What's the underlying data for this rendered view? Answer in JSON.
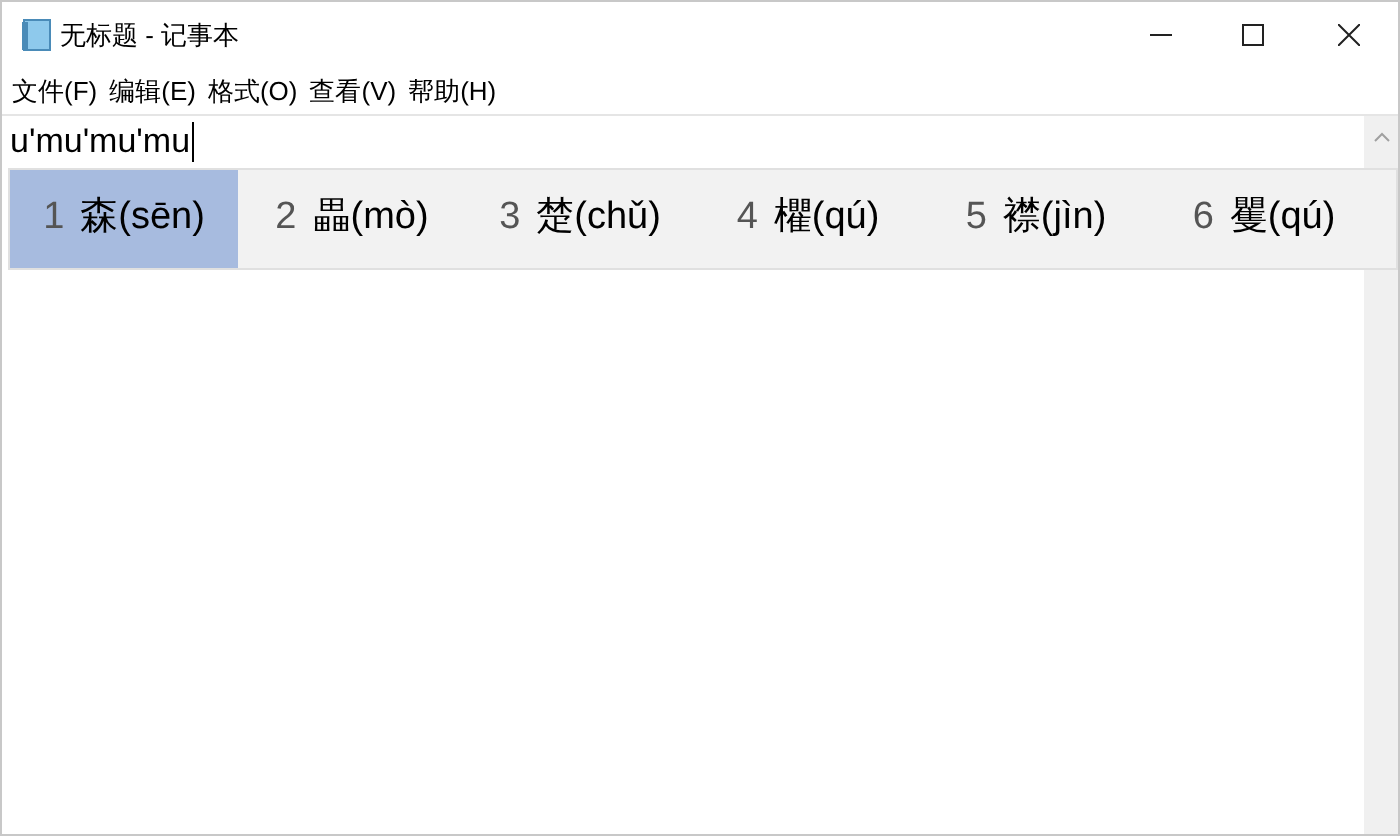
{
  "window": {
    "title": "无标题 - 记事本"
  },
  "menu": [
    "文件(F)",
    "编辑(E)",
    "格式(O)",
    "查看(V)",
    "帮助(H)"
  ],
  "editor": {
    "value": "u'mu'mu'mu"
  },
  "candidates": [
    {
      "number": "1",
      "text": "森(sēn)",
      "selected": true
    },
    {
      "number": "2",
      "text": "畾(mò)",
      "selected": false
    },
    {
      "number": "3",
      "text": "楚(chǔ)",
      "selected": false
    },
    {
      "number": "4",
      "text": "欋(qú)",
      "selected": false
    },
    {
      "number": "5",
      "text": "襟(jìn)",
      "selected": false
    },
    {
      "number": "6",
      "text": "矍(qú)",
      "selected": false
    }
  ]
}
